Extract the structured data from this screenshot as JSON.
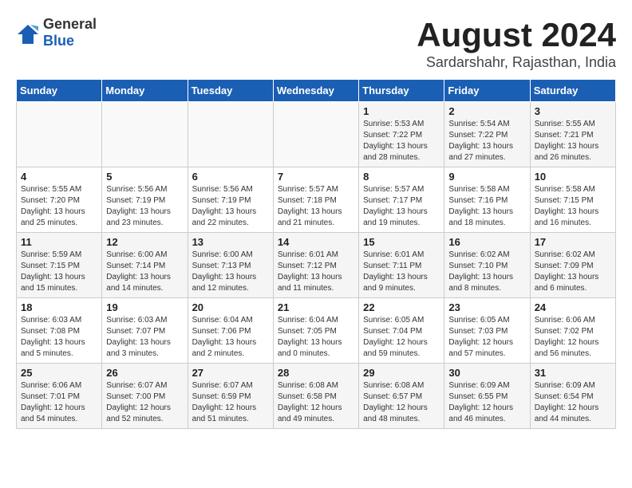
{
  "header": {
    "logo_general": "General",
    "logo_blue": "Blue",
    "title": "August 2024",
    "location": "Sardarshahr, Rajasthan, India"
  },
  "days_of_week": [
    "Sunday",
    "Monday",
    "Tuesday",
    "Wednesday",
    "Thursday",
    "Friday",
    "Saturday"
  ],
  "weeks": [
    [
      {
        "day": "",
        "info": ""
      },
      {
        "day": "",
        "info": ""
      },
      {
        "day": "",
        "info": ""
      },
      {
        "day": "",
        "info": ""
      },
      {
        "day": "1",
        "info": "Sunrise: 5:53 AM\nSunset: 7:22 PM\nDaylight: 13 hours\nand 28 minutes."
      },
      {
        "day": "2",
        "info": "Sunrise: 5:54 AM\nSunset: 7:22 PM\nDaylight: 13 hours\nand 27 minutes."
      },
      {
        "day": "3",
        "info": "Sunrise: 5:55 AM\nSunset: 7:21 PM\nDaylight: 13 hours\nand 26 minutes."
      }
    ],
    [
      {
        "day": "4",
        "info": "Sunrise: 5:55 AM\nSunset: 7:20 PM\nDaylight: 13 hours\nand 25 minutes."
      },
      {
        "day": "5",
        "info": "Sunrise: 5:56 AM\nSunset: 7:19 PM\nDaylight: 13 hours\nand 23 minutes."
      },
      {
        "day": "6",
        "info": "Sunrise: 5:56 AM\nSunset: 7:19 PM\nDaylight: 13 hours\nand 22 minutes."
      },
      {
        "day": "7",
        "info": "Sunrise: 5:57 AM\nSunset: 7:18 PM\nDaylight: 13 hours\nand 21 minutes."
      },
      {
        "day": "8",
        "info": "Sunrise: 5:57 AM\nSunset: 7:17 PM\nDaylight: 13 hours\nand 19 minutes."
      },
      {
        "day": "9",
        "info": "Sunrise: 5:58 AM\nSunset: 7:16 PM\nDaylight: 13 hours\nand 18 minutes."
      },
      {
        "day": "10",
        "info": "Sunrise: 5:58 AM\nSunset: 7:15 PM\nDaylight: 13 hours\nand 16 minutes."
      }
    ],
    [
      {
        "day": "11",
        "info": "Sunrise: 5:59 AM\nSunset: 7:15 PM\nDaylight: 13 hours\nand 15 minutes."
      },
      {
        "day": "12",
        "info": "Sunrise: 6:00 AM\nSunset: 7:14 PM\nDaylight: 13 hours\nand 14 minutes."
      },
      {
        "day": "13",
        "info": "Sunrise: 6:00 AM\nSunset: 7:13 PM\nDaylight: 13 hours\nand 12 minutes."
      },
      {
        "day": "14",
        "info": "Sunrise: 6:01 AM\nSunset: 7:12 PM\nDaylight: 13 hours\nand 11 minutes."
      },
      {
        "day": "15",
        "info": "Sunrise: 6:01 AM\nSunset: 7:11 PM\nDaylight: 13 hours\nand 9 minutes."
      },
      {
        "day": "16",
        "info": "Sunrise: 6:02 AM\nSunset: 7:10 PM\nDaylight: 13 hours\nand 8 minutes."
      },
      {
        "day": "17",
        "info": "Sunrise: 6:02 AM\nSunset: 7:09 PM\nDaylight: 13 hours\nand 6 minutes."
      }
    ],
    [
      {
        "day": "18",
        "info": "Sunrise: 6:03 AM\nSunset: 7:08 PM\nDaylight: 13 hours\nand 5 minutes."
      },
      {
        "day": "19",
        "info": "Sunrise: 6:03 AM\nSunset: 7:07 PM\nDaylight: 13 hours\nand 3 minutes."
      },
      {
        "day": "20",
        "info": "Sunrise: 6:04 AM\nSunset: 7:06 PM\nDaylight: 13 hours\nand 2 minutes."
      },
      {
        "day": "21",
        "info": "Sunrise: 6:04 AM\nSunset: 7:05 PM\nDaylight: 13 hours\nand 0 minutes."
      },
      {
        "day": "22",
        "info": "Sunrise: 6:05 AM\nSunset: 7:04 PM\nDaylight: 12 hours\nand 59 minutes."
      },
      {
        "day": "23",
        "info": "Sunrise: 6:05 AM\nSunset: 7:03 PM\nDaylight: 12 hours\nand 57 minutes."
      },
      {
        "day": "24",
        "info": "Sunrise: 6:06 AM\nSunset: 7:02 PM\nDaylight: 12 hours\nand 56 minutes."
      }
    ],
    [
      {
        "day": "25",
        "info": "Sunrise: 6:06 AM\nSunset: 7:01 PM\nDaylight: 12 hours\nand 54 minutes."
      },
      {
        "day": "26",
        "info": "Sunrise: 6:07 AM\nSunset: 7:00 PM\nDaylight: 12 hours\nand 52 minutes."
      },
      {
        "day": "27",
        "info": "Sunrise: 6:07 AM\nSunset: 6:59 PM\nDaylight: 12 hours\nand 51 minutes."
      },
      {
        "day": "28",
        "info": "Sunrise: 6:08 AM\nSunset: 6:58 PM\nDaylight: 12 hours\nand 49 minutes."
      },
      {
        "day": "29",
        "info": "Sunrise: 6:08 AM\nSunset: 6:57 PM\nDaylight: 12 hours\nand 48 minutes."
      },
      {
        "day": "30",
        "info": "Sunrise: 6:09 AM\nSunset: 6:55 PM\nDaylight: 12 hours\nand 46 minutes."
      },
      {
        "day": "31",
        "info": "Sunrise: 6:09 AM\nSunset: 6:54 PM\nDaylight: 12 hours\nand 44 minutes."
      }
    ]
  ]
}
